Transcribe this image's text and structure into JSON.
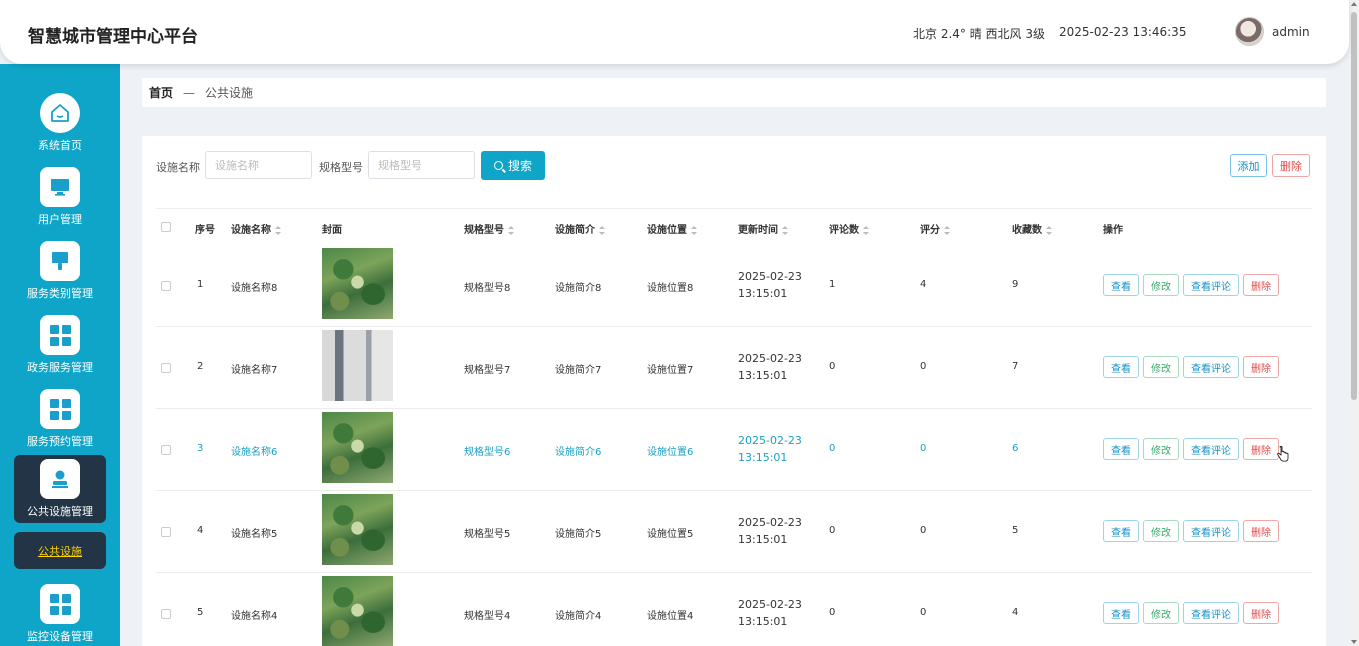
{
  "header": {
    "app_title": "智慧城市管理中心平台",
    "weather": "北京  2.4°  晴  西北风  3级",
    "datetime": "2025-02-23 13:46:35",
    "username": "admin"
  },
  "sidebar": {
    "items": [
      {
        "label": "系统首页",
        "icon": "home-icon"
      },
      {
        "label": "用户管理",
        "icon": "monitor-icon"
      },
      {
        "label": "服务类别管理",
        "icon": "brush-icon"
      },
      {
        "label": "政务服务管理",
        "icon": "grid-icon"
      },
      {
        "label": "服务预约管理",
        "icon": "grid-icon"
      },
      {
        "label": "公共设施管理",
        "icon": "user-stamp-icon"
      },
      {
        "label": "监控设备管理",
        "icon": "grid-icon"
      }
    ],
    "sub_item": "公共设施"
  },
  "breadcrumb": {
    "home": "首页",
    "separator": "—",
    "current": "公共设施"
  },
  "filters": {
    "name_label": "设施名称",
    "name_placeholder": "设施名称",
    "spec_label": "规格型号",
    "spec_placeholder": "规格型号",
    "search_label": "搜索"
  },
  "toolbar": {
    "add_label": "添加",
    "delete_label": "删除"
  },
  "table": {
    "headers": {
      "index": "序号",
      "name": "设施名称",
      "cover": "封面",
      "spec": "规格型号",
      "intro": "设施简介",
      "location": "设施位置",
      "updated": "更新时间",
      "comments": "评论数",
      "rating": "评分",
      "favorites": "收藏数",
      "actions": "操作"
    },
    "rows": [
      {
        "index": "1",
        "name": "设施名称8",
        "spec": "规格型号8",
        "intro": "设施简介8",
        "location": "设施位置8",
        "updated": "2025-02-23 13:15:01",
        "comments": "1",
        "rating": "4",
        "favorites": "9",
        "cover": "park"
      },
      {
        "index": "2",
        "name": "设施名称7",
        "spec": "规格型号7",
        "intro": "设施简介7",
        "location": "设施位置7",
        "updated": "2025-02-23 13:15:01",
        "comments": "0",
        "rating": "0",
        "favorites": "7",
        "cover": "office"
      },
      {
        "index": "3",
        "name": "设施名称6",
        "spec": "规格型号6",
        "intro": "设施简介6",
        "location": "设施位置6",
        "updated": "2025-02-23 13:15:01",
        "comments": "0",
        "rating": "0",
        "favorites": "6",
        "cover": "park"
      },
      {
        "index": "4",
        "name": "设施名称5",
        "spec": "规格型号5",
        "intro": "设施简介5",
        "location": "设施位置5",
        "updated": "2025-02-23 13:15:01",
        "comments": "0",
        "rating": "0",
        "favorites": "5",
        "cover": "park"
      },
      {
        "index": "5",
        "name": "设施名称4",
        "spec": "规格型号4",
        "intro": "设施简介4",
        "location": "设施位置4",
        "updated": "2025-02-23 13:15:01",
        "comments": "0",
        "rating": "0",
        "favorites": "4",
        "cover": "park"
      }
    ],
    "actions": {
      "view": "查看",
      "edit": "修改",
      "comments": "查看评论",
      "delete": "删除"
    }
  },
  "colors": {
    "accent": "#0ea5c9",
    "sidebar_active": "#233446",
    "hover_text": "#1aa1c4",
    "danger": "#e04b4b"
  }
}
